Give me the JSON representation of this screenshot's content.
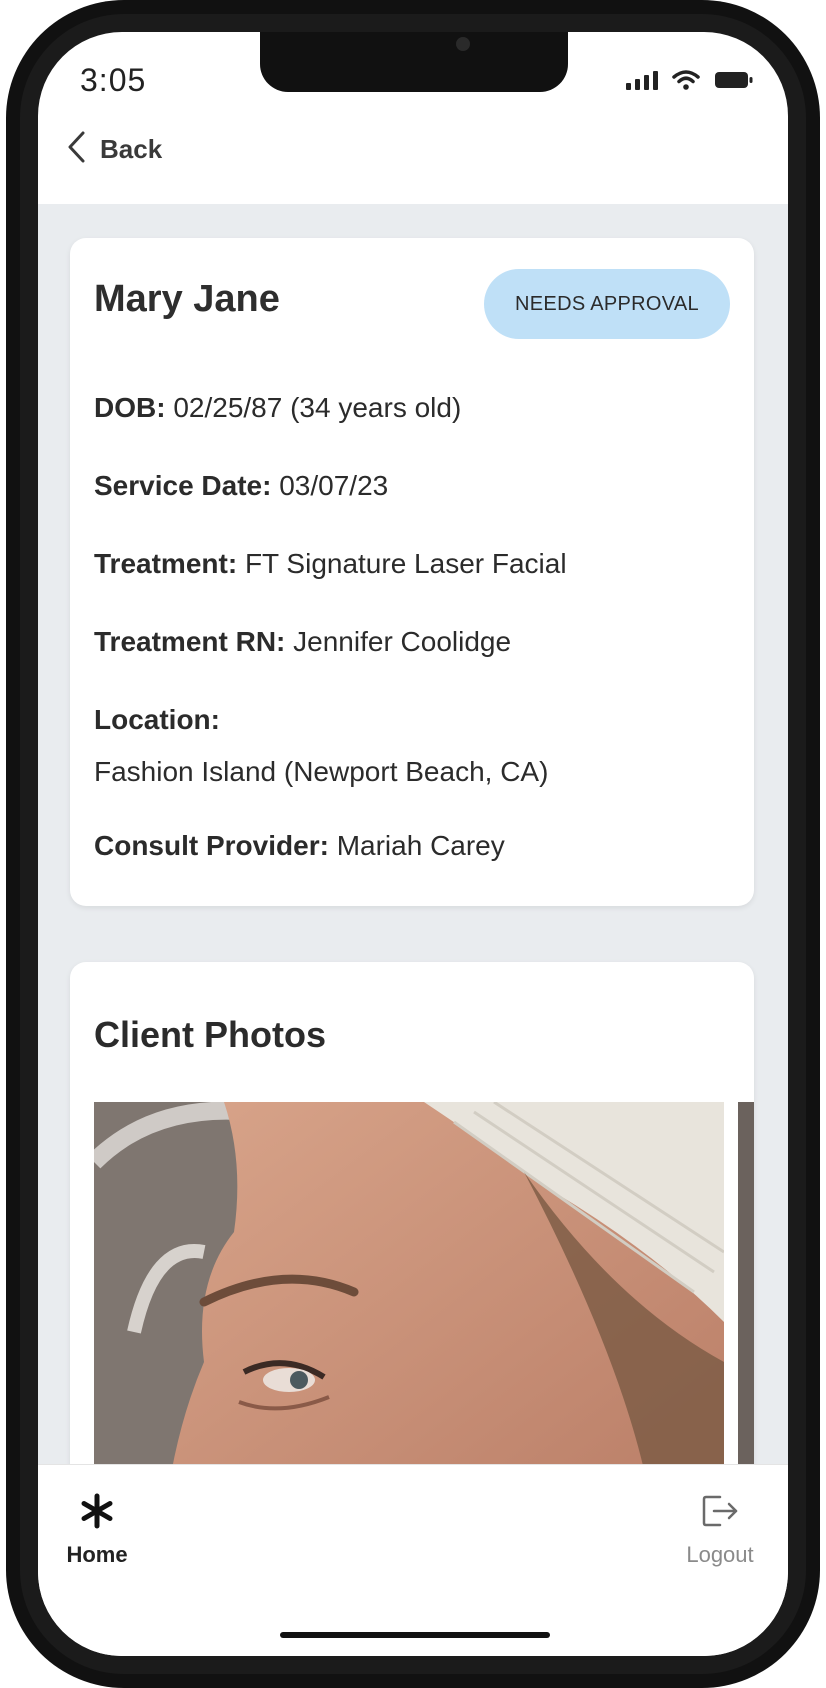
{
  "status_bar": {
    "time": "3:05"
  },
  "nav": {
    "back_label": "Back"
  },
  "patient": {
    "name": "Mary Jane",
    "status_badge": "NEEDS APPROVAL",
    "fields": {
      "dob": {
        "label": "DOB:",
        "value": "02/25/87 (34 years old)"
      },
      "service_date": {
        "label": "Service Date:",
        "value": "03/07/23"
      },
      "treatment": {
        "label": "Treatment:",
        "value": "FT Signature Laser Facial"
      },
      "treatment_rn": {
        "label": "Treatment RN:",
        "value": "Jennifer Coolidge"
      },
      "location": {
        "label": "Location:",
        "value": "Fashion Island (Newport Beach, CA)"
      },
      "consult_provider": {
        "label": "Consult Provider:",
        "value": "Mariah Carey"
      }
    }
  },
  "photos": {
    "title": "Client Photos"
  },
  "tabbar": {
    "home_label": "Home",
    "logout_label": "Logout"
  },
  "colors": {
    "badge_bg": "#bfe0f7",
    "content_bg": "#e9ecef",
    "inactive_tab": "#8a8a8a"
  },
  "icons": [
    "chevron-left-icon",
    "signal-icon",
    "wifi-icon",
    "battery-icon",
    "asterisk-home-icon",
    "logout-icon"
  ]
}
